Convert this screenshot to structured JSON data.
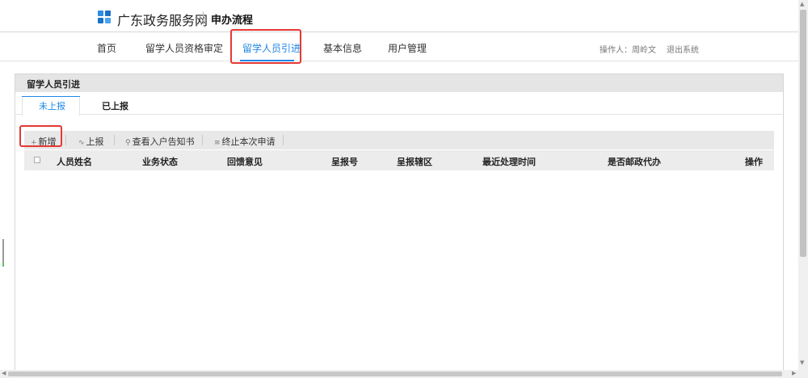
{
  "header": {
    "site_name": "广东政务服务网",
    "page_name": "申办流程"
  },
  "nav": {
    "items": [
      {
        "label": "首页"
      },
      {
        "label": "留学人员资格审定"
      },
      {
        "label": "留学人员引进"
      },
      {
        "label": "基本信息"
      },
      {
        "label": "用户管理"
      }
    ],
    "active_index": 2,
    "operator": "操作人：周岭文",
    "logout": "退出系统"
  },
  "panel": {
    "title": "留学人员引进",
    "tabs": [
      {
        "label": "未上报"
      },
      {
        "label": "已上报"
      }
    ],
    "active_tab": 0
  },
  "toolbar": {
    "buttons": [
      {
        "icon": "+",
        "icon_name": "plus-icon",
        "label": "新增"
      },
      {
        "icon": "∿",
        "icon_name": "report-icon",
        "label": "上报"
      },
      {
        "icon": "⚲",
        "icon_name": "search-icon",
        "label": "查看入户告知书"
      },
      {
        "icon": "≡",
        "icon_name": "list-icon",
        "label": "终止本次申请"
      }
    ]
  },
  "table": {
    "columns": [
      "人员姓名",
      "业务状态",
      "回馈意见",
      "呈报号",
      "呈报辖区",
      "最近处理时间",
      "是否邮政代办",
      "操作"
    ],
    "rows": []
  },
  "colors": {
    "accent": "#1e88e5",
    "highlight": "#e53935",
    "logo": "#1e7fd8"
  }
}
